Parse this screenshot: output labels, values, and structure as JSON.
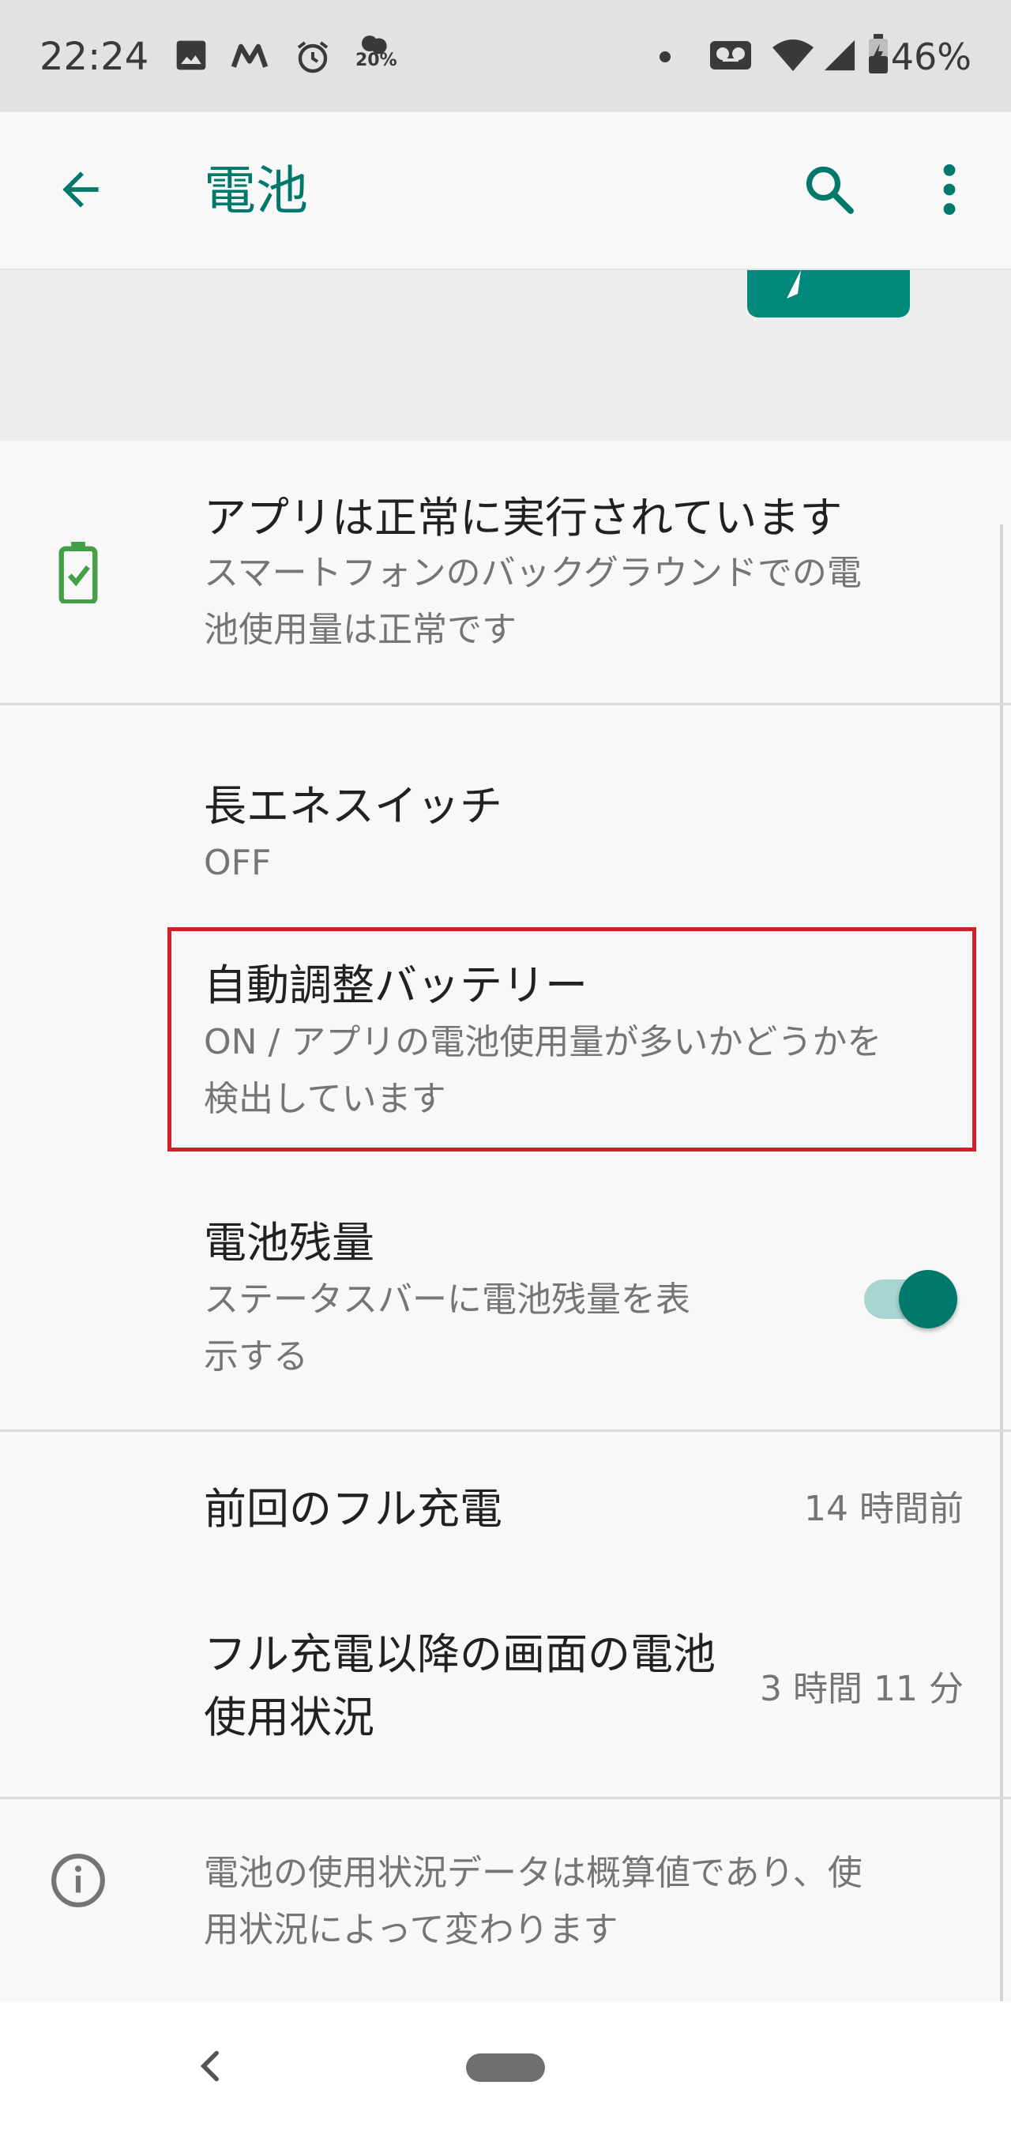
{
  "status_bar": {
    "time": "22:24",
    "weather_text": "20%",
    "battery_percent": "46%",
    "icons": [
      "image-icon",
      "m-icon",
      "alarm-icon",
      "weather-icon",
      "dot-icon",
      "voicemail-icon",
      "wifi-icon",
      "signal-icon",
      "battery-icon"
    ]
  },
  "app_bar": {
    "title": "電池",
    "back_icon": "arrow-back-icon",
    "search_icon": "search-icon",
    "more_icon": "more-vert-icon"
  },
  "status_item": {
    "title": "アプリは正常に実行されています",
    "subtitle_line1": "スマートフォンのバックグラウンドでの電",
    "subtitle_line2": "池使用量は正常です",
    "icon": "battery-check-icon"
  },
  "battery_saver": {
    "title": "長エネスイッチ",
    "value": "OFF"
  },
  "adaptive_battery": {
    "title": "自動調整バッテリー",
    "subtitle_line1": "ON / アプリの電池使用量が多いかどうかを",
    "subtitle_line2": "検出しています"
  },
  "battery_percentage": {
    "title": "電池残量",
    "subtitle_line1": "ステータスバーに電池残量を表",
    "subtitle_line2": "示する",
    "toggle_on": true
  },
  "last_full_charge": {
    "title": "前回のフル充電",
    "value": "14 時間前"
  },
  "screen_usage": {
    "title_line1": "フル充電以降の画面の電池",
    "title_line2": "使用状況",
    "value": "3 時間 11 分"
  },
  "footer_info": {
    "line1": "電池の使用状況データは概算値であり、使",
    "line2": "用状況によって変わります",
    "icon": "info-icon"
  },
  "colors": {
    "accent": "#00796b",
    "highlight": "#d3202d",
    "battery_ok": "#43a047"
  }
}
